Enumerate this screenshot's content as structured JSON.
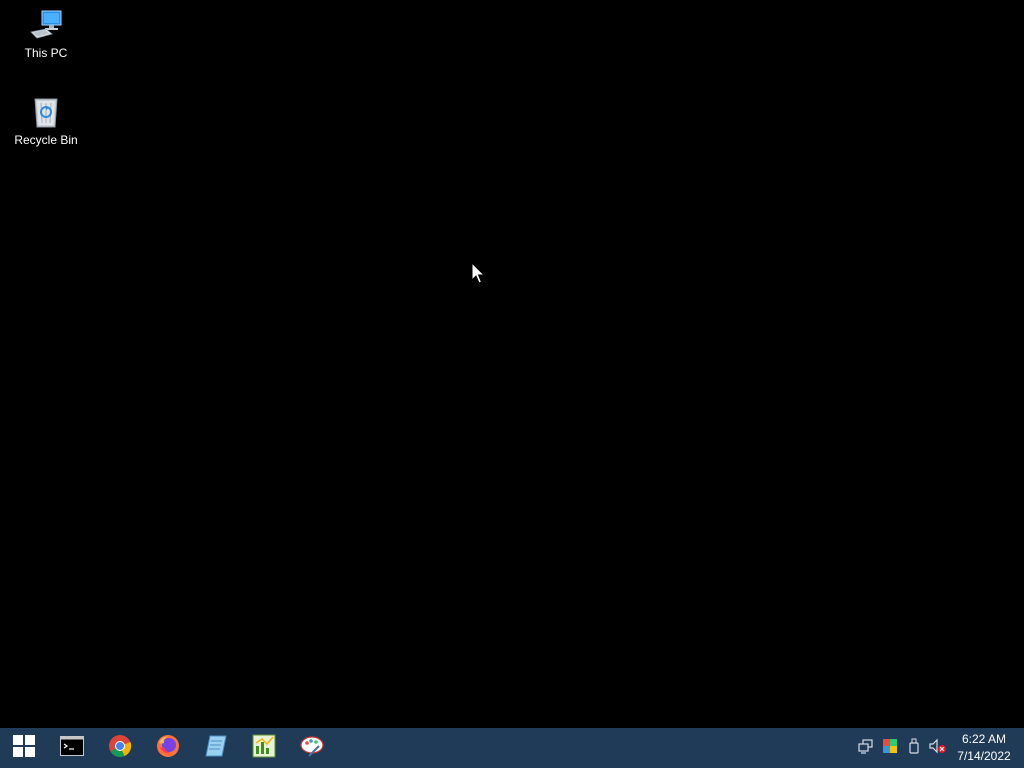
{
  "desktop": {
    "icons": [
      {
        "label": "This PC",
        "icon": "this-pc-icon"
      },
      {
        "label": "Recycle Bin",
        "icon": "recycle-bin-icon"
      }
    ]
  },
  "taskbar": {
    "apps": [
      {
        "icon": "start-windows-icon"
      },
      {
        "icon": "command-prompt-icon"
      },
      {
        "icon": "chrome-icon"
      },
      {
        "icon": "firefox-icon"
      },
      {
        "icon": "notepad-icon"
      },
      {
        "icon": "spreadsheet-chart-icon"
      },
      {
        "icon": "paint-palette-icon"
      }
    ],
    "tray": [
      {
        "icon": "network-icon"
      },
      {
        "icon": "display-color-icon"
      },
      {
        "icon": "usb-drive-icon"
      },
      {
        "icon": "volume-muted-icon"
      }
    ],
    "clock": {
      "time": "6:22 AM",
      "date": "7/14/2022"
    }
  },
  "colors": {
    "desktop_background": "#000000",
    "taskbar_background": "#1f3b57",
    "text": "#ffffff"
  }
}
